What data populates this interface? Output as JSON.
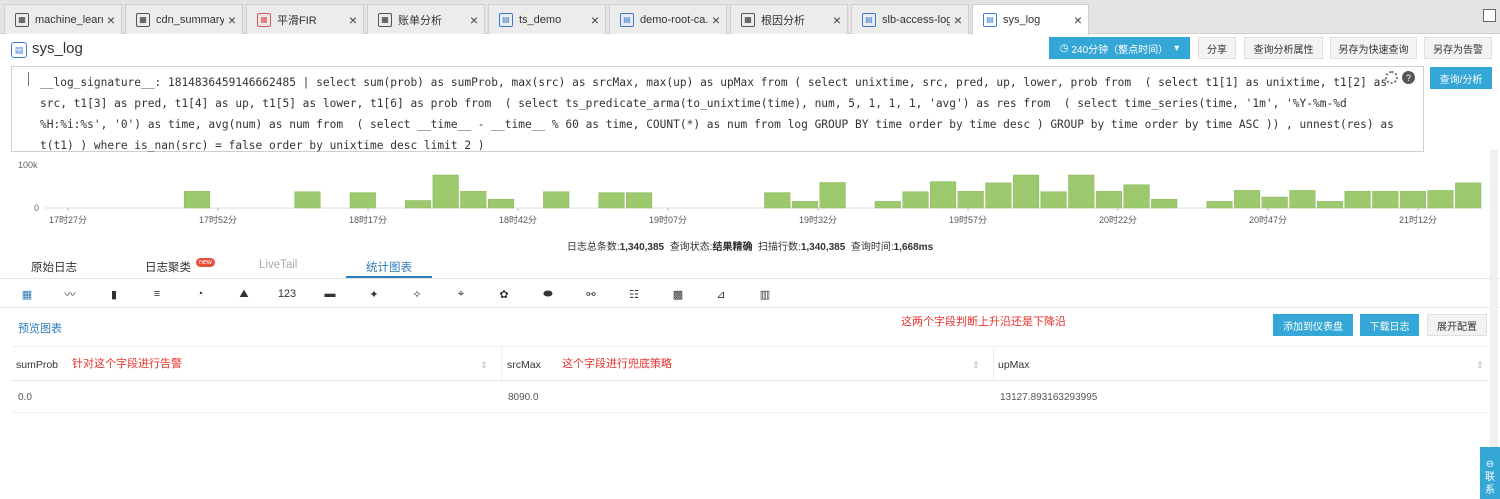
{
  "tabs": [
    {
      "label": "machine_learni...",
      "icon": "dashboard-icon",
      "variant": "dark",
      "glyph": "▦"
    },
    {
      "label": "cdn_summary",
      "icon": "dashboard-icon",
      "variant": "dark",
      "glyph": "▦"
    },
    {
      "label": "平滑FIR",
      "icon": "dashboard-icon",
      "variant": "red",
      "glyph": "▦"
    },
    {
      "label": "账单分析",
      "icon": "dashboard-icon",
      "variant": "dark",
      "glyph": "▦"
    },
    {
      "label": "ts_demo",
      "icon": "logstore-icon",
      "variant": "blue",
      "glyph": "▤"
    },
    {
      "label": "demo-root-ca...",
      "icon": "logstore-icon",
      "variant": "blue",
      "glyph": "▤"
    },
    {
      "label": "根因分析",
      "icon": "dashboard-icon",
      "variant": "dark",
      "glyph": "▦"
    },
    {
      "label": "slb-access-log",
      "icon": "logstore-icon",
      "variant": "blue",
      "glyph": "▤"
    },
    {
      "label": "sys_log",
      "icon": "logstore-icon",
      "variant": "blue",
      "glyph": "▤",
      "active": true
    }
  ],
  "page": {
    "title": "sys_log",
    "time_range": "240分钟（整点时间）",
    "share": "分享",
    "query_props": "查询分析属性",
    "save_search": "另存为快速查询",
    "save_alert": "另存为告警",
    "search_btn": "查询/分析"
  },
  "query_text": "__log_signature__: 1814836459146662485 | select sum(prob) as sumProb, max(src) as srcMax, max(up) as upMax from ( select unixtime, src, pred, up, lower, prob from  ( select t1[1] as unixtime, t1[2] as src, t1[3] as pred, t1[4] as up, t1[5] as lower, t1[6] as prob from  ( select ts_predicate_arma(to_unixtime(time), num, 5, 1, 1, 1, 'avg') as res from  ( select time_series(time, '1m', '%Y-%m-%d %H:%i:%s', '0') as time, avg(num) as num from  ( select __time__ - __time__ % 60 as time, COUNT(*) as num from log GROUP BY time order by time desc ) GROUP by time order by time ASC )) , unnest(res) as t(t1) ) where is_nan(src) = false order by unixtime desc limit 2 )",
  "histogram": {
    "y_labels": [
      "100k",
      "0"
    ],
    "x_labels": [
      "17时27分",
      "17时52分",
      "18时17分",
      "18时42分",
      "19时07分",
      "19时32分",
      "19时57分",
      "20时22分",
      "20时47分",
      "21时12分"
    ],
    "color": "#9dc96e",
    "values": [
      0,
      0,
      0,
      0,
      0,
      38,
      0,
      0,
      0,
      37,
      0,
      35,
      0,
      17,
      75,
      38,
      20,
      0,
      37,
      0,
      35,
      35,
      0,
      0,
      0,
      0,
      35,
      15,
      58,
      0,
      15,
      37,
      60,
      38,
      57,
      75,
      37,
      75,
      38,
      53,
      20,
      0,
      15,
      40,
      25,
      40,
      15,
      38,
      38,
      38,
      40,
      57
    ]
  },
  "summary": {
    "total_label": "日志总条数:",
    "total": "1,340,385",
    "status_label": "查询状态:",
    "status": "结果精确",
    "rows_label": "扫描行数:",
    "rows": "1,340,385",
    "time_label": "查询时间:",
    "time": "1,668ms"
  },
  "lower_tabs": {
    "raw": "原始日志",
    "cluster": "日志聚类",
    "new_badge": "new",
    "livetail": "LiveTail",
    "chart": "统计图表"
  },
  "chart_icons": [
    {
      "name": "table-chart-icon",
      "glyph": "▦"
    },
    {
      "name": "line-chart-icon",
      "glyph": "〰"
    },
    {
      "name": "bar-chart-icon",
      "glyph": "▮"
    },
    {
      "name": "horizontal-bar-icon",
      "glyph": "≡"
    },
    {
      "name": "pie-chart-icon",
      "glyph": "◔"
    },
    {
      "name": "area-chart-icon",
      "glyph": "⛰"
    },
    {
      "name": "number-chart-icon",
      "glyph": "123"
    },
    {
      "name": "progress-bar-icon",
      "glyph": "▬"
    },
    {
      "name": "china-map-icon",
      "glyph": "✦"
    },
    {
      "name": "world-map-icon",
      "glyph": "✧"
    },
    {
      "name": "map-pin-icon",
      "glyph": "⌖"
    },
    {
      "name": "flow-chart-icon",
      "glyph": "✿"
    },
    {
      "name": "bus-chart-icon",
      "glyph": "⬬"
    },
    {
      "name": "sankey-icon",
      "glyph": "⚯"
    },
    {
      "name": "wordcloud-icon",
      "glyph": "☷"
    },
    {
      "name": "treemap-icon",
      "glyph": "▩"
    },
    {
      "name": "multi-line-icon",
      "glyph": "⊿"
    },
    {
      "name": "calendar-grid-icon",
      "glyph": "▥"
    }
  ],
  "preview_label": "预览图表",
  "annotations": {
    "fields_trend": "这两个字段判断上升沿还是下降沿",
    "alert_field": "针对这个字段进行告警",
    "fallback_field": "这个字段进行兜底策略"
  },
  "actions": {
    "add_dashboard": "添加到仪表盘",
    "download": "下载日志",
    "expand": "展开配置"
  },
  "table": {
    "headers": [
      "sumProb",
      "srcMax",
      "upMax"
    ],
    "rows": [
      [
        "0.0",
        "8090.0",
        "13127.893163293995"
      ]
    ]
  },
  "contact": [
    "联",
    "系"
  ]
}
